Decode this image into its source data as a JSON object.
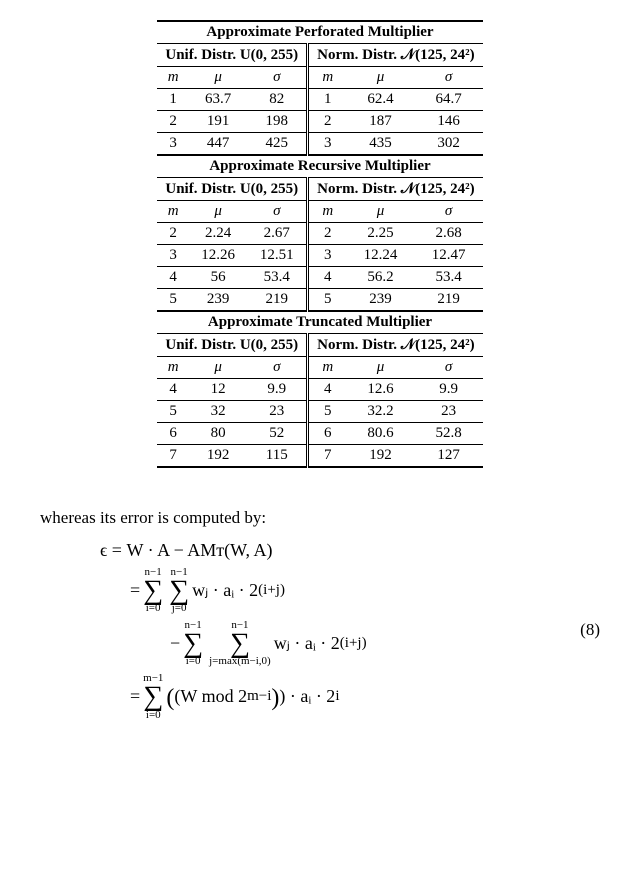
{
  "sections": [
    {
      "title": "Approximate Perforated Multiplier",
      "unif_label": "Unif. Distr. U(0, 255)",
      "norm_label": "Norm. Distr. 𝒩(125, 24²)",
      "head": {
        "m": "m",
        "mu": "μ",
        "sigma": "σ"
      },
      "rows": [
        {
          "u_m": "1",
          "u_mu": "63.7",
          "u_s": "82",
          "n_m": "1",
          "n_mu": "62.4",
          "n_s": "64.7"
        },
        {
          "u_m": "2",
          "u_mu": "191",
          "u_s": "198",
          "n_m": "2",
          "n_mu": "187",
          "n_s": "146"
        },
        {
          "u_m": "3",
          "u_mu": "447",
          "u_s": "425",
          "n_m": "3",
          "n_mu": "435",
          "n_s": "302"
        }
      ]
    },
    {
      "title": "Approximate Recursive Multiplier",
      "unif_label": "Unif. Distr. U(0, 255)",
      "norm_label": "Norm. Distr. 𝒩(125, 24²)",
      "head": {
        "m": "m",
        "mu": "μ",
        "sigma": "σ"
      },
      "rows": [
        {
          "u_m": "2",
          "u_mu": "2.24",
          "u_s": "2.67",
          "n_m": "2",
          "n_mu": "2.25",
          "n_s": "2.68"
        },
        {
          "u_m": "3",
          "u_mu": "12.26",
          "u_s": "12.51",
          "n_m": "3",
          "n_mu": "12.24",
          "n_s": "12.47"
        },
        {
          "u_m": "4",
          "u_mu": "56",
          "u_s": "53.4",
          "n_m": "4",
          "n_mu": "56.2",
          "n_s": "53.4"
        },
        {
          "u_m": "5",
          "u_mu": "239",
          "u_s": "219",
          "n_m": "5",
          "n_mu": "239",
          "n_s": "219"
        }
      ]
    },
    {
      "title": "Approximate Truncated Multiplier",
      "unif_label": "Unif. Distr. U(0, 255)",
      "norm_label": "Norm. Distr. 𝒩(125, 24²)",
      "head": {
        "m": "m",
        "mu": "μ",
        "sigma": "σ"
      },
      "rows": [
        {
          "u_m": "4",
          "u_mu": "12",
          "u_s": "9.9",
          "n_m": "4",
          "n_mu": "12.6",
          "n_s": "9.9"
        },
        {
          "u_m": "5",
          "u_mu": "32",
          "u_s": "23",
          "n_m": "5",
          "n_mu": "32.2",
          "n_s": "23"
        },
        {
          "u_m": "6",
          "u_mu": "80",
          "u_s": "52",
          "n_m": "6",
          "n_mu": "80.6",
          "n_s": "52.8"
        },
        {
          "u_m": "7",
          "u_mu": "192",
          "u_s": "115",
          "n_m": "7",
          "n_mu": "192",
          "n_s": "127"
        }
      ]
    }
  ],
  "text": {
    "intro": "whereas its error is computed by:",
    "eqnum": "(8)",
    "eq_l1": "ϵ = W · A − AMᴛ(W, A)",
    "eq_l2a": "= ",
    "eq_l2b": " wⱼ · aᵢ · 2",
    "eq_l2exp": "(i+j)",
    "eq_l3a": "− ",
    "eq_l3b": " wⱼ · aᵢ · 2",
    "eq_l3exp": "(i+j)",
    "eq_l4a": "= ",
    "eq_l4b": " (W mod 2",
    "eq_l4exp": "m−i",
    "eq_l4c": ") · aᵢ · 2",
    "eq_l4exp2": "i",
    "sum_top_n1": "n−1",
    "sum_bot_i0": "i=0",
    "sum_bot_j0": "j=0",
    "sum_bot_jmax": "j=max(m−i,0)",
    "sum_top_m1": "m−1"
  }
}
